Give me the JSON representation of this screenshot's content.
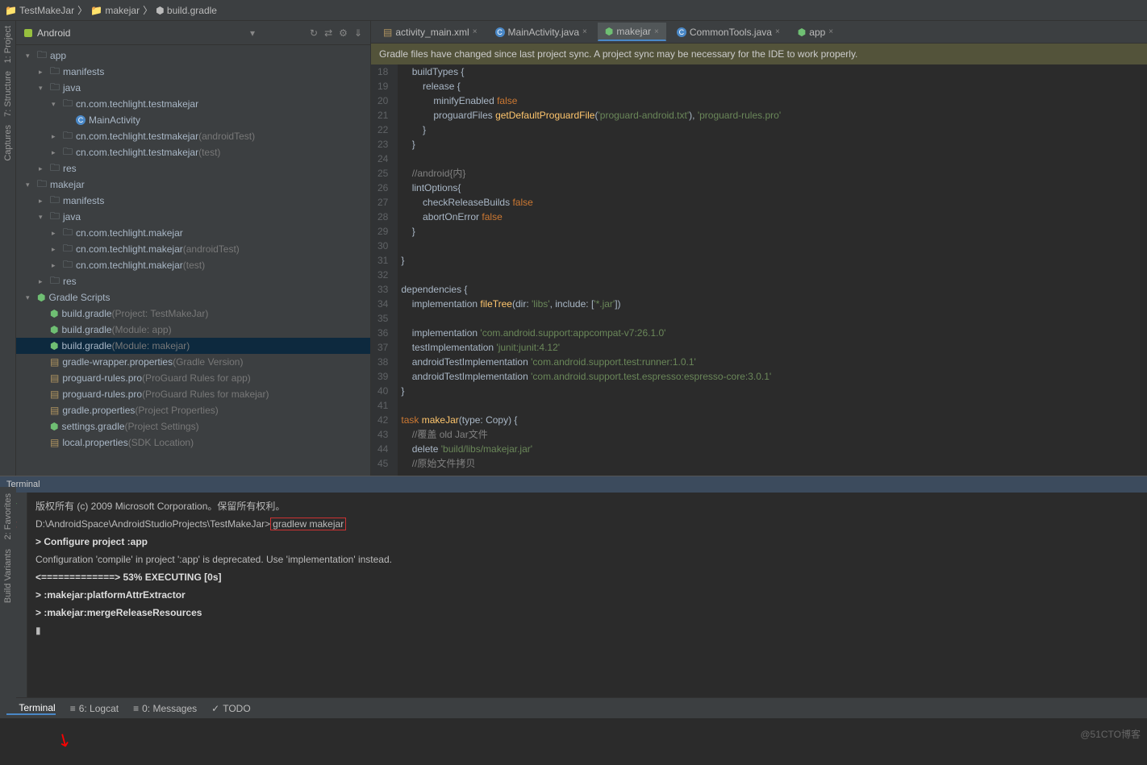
{
  "breadcrumb": {
    "a": "TestMakeJar",
    "b": "makejar",
    "c": "build.gradle"
  },
  "sidebar": {
    "title": "Android",
    "icons": [
      "↻",
      "⇄",
      "⚙",
      "⇓"
    ],
    "tree": [
      {
        "ind": 0,
        "arr": "▾",
        "ico": "📁",
        "txt": "app",
        "cls": "ic-folder"
      },
      {
        "ind": 1,
        "arr": "▸",
        "ico": "📁",
        "txt": "manifests"
      },
      {
        "ind": 1,
        "arr": "▾",
        "ico": "📁",
        "txt": "java"
      },
      {
        "ind": 2,
        "arr": "▾",
        "ico": "📁",
        "txt": "cn.com.techlight.testmakejar"
      },
      {
        "ind": 3,
        "arr": "",
        "ico": "C",
        "txt": "MainActivity"
      },
      {
        "ind": 2,
        "arr": "▸",
        "ico": "📁",
        "txt": "cn.com.techlight.testmakejar",
        "dim": "(androidTest)"
      },
      {
        "ind": 2,
        "arr": "▸",
        "ico": "📁",
        "txt": "cn.com.techlight.testmakejar",
        "dim": "(test)"
      },
      {
        "ind": 1,
        "arr": "▸",
        "ico": "📁",
        "txt": "res"
      },
      {
        "ind": 0,
        "arr": "▾",
        "ico": "📁",
        "txt": "makejar"
      },
      {
        "ind": 1,
        "arr": "▸",
        "ico": "📁",
        "txt": "manifests"
      },
      {
        "ind": 1,
        "arr": "▾",
        "ico": "📁",
        "txt": "java"
      },
      {
        "ind": 2,
        "arr": "▸",
        "ico": "📁",
        "txt": "cn.com.techlight.makejar"
      },
      {
        "ind": 2,
        "arr": "▸",
        "ico": "📁",
        "txt": "cn.com.techlight.makejar",
        "dim": "(androidTest)"
      },
      {
        "ind": 2,
        "arr": "▸",
        "ico": "📁",
        "txt": "cn.com.techlight.makejar",
        "dim": "(test)"
      },
      {
        "ind": 1,
        "arr": "▸",
        "ico": "📁",
        "txt": "res"
      },
      {
        "ind": 0,
        "arr": "▾",
        "ico": "⬢",
        "txt": "Gradle Scripts",
        "cls": "ic-gradle"
      },
      {
        "ind": 1,
        "arr": "",
        "ico": "⬢",
        "txt": "build.gradle",
        "dim": "(Project: TestMakeJar)"
      },
      {
        "ind": 1,
        "arr": "",
        "ico": "⬢",
        "txt": "build.gradle",
        "dim": "(Module: app)"
      },
      {
        "ind": 1,
        "arr": "",
        "ico": "⬢",
        "txt": "build.gradle",
        "dim": "(Module: makejar)",
        "sel": true
      },
      {
        "ind": 1,
        "arr": "",
        "ico": "📄",
        "txt": "gradle-wrapper.properties",
        "dim": "(Gradle Version)"
      },
      {
        "ind": 1,
        "arr": "",
        "ico": "📄",
        "txt": "proguard-rules.pro",
        "dim": "(ProGuard Rules for app)"
      },
      {
        "ind": 1,
        "arr": "",
        "ico": "📄",
        "txt": "proguard-rules.pro",
        "dim": "(ProGuard Rules for makejar)"
      },
      {
        "ind": 1,
        "arr": "",
        "ico": "📄",
        "txt": "gradle.properties",
        "dim": "(Project Properties)"
      },
      {
        "ind": 1,
        "arr": "",
        "ico": "⬢",
        "txt": "settings.gradle",
        "dim": "(Project Settings)"
      },
      {
        "ind": 1,
        "arr": "",
        "ico": "📄",
        "txt": "local.properties",
        "dim": "(SDK Location)"
      }
    ]
  },
  "leftTools": [
    "1: Project",
    "7: Structure",
    "Captures"
  ],
  "leftTools2": [
    "2: Favorites",
    "Build Variants"
  ],
  "tabs": [
    {
      "ico": "📄",
      "label": "activity_main.xml"
    },
    {
      "ico": "C",
      "label": "MainActivity.java"
    },
    {
      "ico": "⬢",
      "label": "makejar",
      "active": true
    },
    {
      "ico": "C",
      "label": "CommonTools.java"
    },
    {
      "ico": "⬢",
      "label": "app"
    }
  ],
  "banner": "Gradle files have changed since last project sync. A project sync may be necessary for the IDE to work properly.",
  "code": {
    "start": 18,
    "lines": [
      "    buildTypes {",
      "        release {",
      "            minifyEnabled <kw>false</kw>",
      "            proguardFiles <fn>getDefaultProguardFile</fn>(<str>'proguard-android.txt'</str>), <str>'proguard-rules.pro'</str>",
      "        }",
      "    }",
      "",
      "    <cmt>//android{内}</cmt>",
      "    lintOptions{",
      "        checkReleaseBuilds <kw>false</kw>",
      "        abortOnError <kw>false</kw>",
      "    }",
      "",
      "}",
      "",
      "dependencies {",
      "    implementation <fn>fileTree</fn>(dir: <str>'libs'</str>, include: [<str>'*.jar'</str>])",
      "",
      "    implementation <str>'com.android.support:appcompat-v7:26.1.0'</str>",
      "    testImplementation <str>'junit:junit:4.12'</str>",
      "    androidTestImplementation <str>'com.android.support.test:runner:1.0.1'</str>",
      "    androidTestImplementation <str>'com.android.support.test.espresso:espresso-core:3.0.1'</str>",
      "}",
      "",
      "<kw>task</kw> <fn>makeJar</fn>(type: Copy) {",
      "    <cmt>//覆盖 old Jar文件</cmt>",
      "    delete <str>'build/libs/makejar.jar'</str>",
      "    <cmt>//原始文件拷贝</cmt>"
    ]
  },
  "terminal": {
    "title": "Terminal",
    "lines": [
      "版权所有 (c) 2009 Microsoft Corporation。保留所有权利。",
      "",
      "D:\\AndroidSpace\\AndroidStudioProjects\\TestMakeJar><red>gradlew makejar</red>",
      "",
      "",
      "<b>> Configure project :app</b>",
      "Configuration 'compile' in project ':app' is deprecated. Use 'implementation' instead.",
      "<b><=============> 53% EXECUTING [0s]</b>",
      "<b>> :makejar:platformAttrExtractor</b>",
      "<b>> :makejar:mergeReleaseResources</b>",
      "▮"
    ]
  },
  "bottomTabs": [
    {
      "ico": "▣",
      "label": "Terminal",
      "active": true
    },
    {
      "ico": "≡",
      "label": "6: Logcat"
    },
    {
      "ico": "≡",
      "label": "0: Messages"
    },
    {
      "ico": "✓",
      "label": "TODO"
    }
  ],
  "watermark": "@51CTO博客"
}
